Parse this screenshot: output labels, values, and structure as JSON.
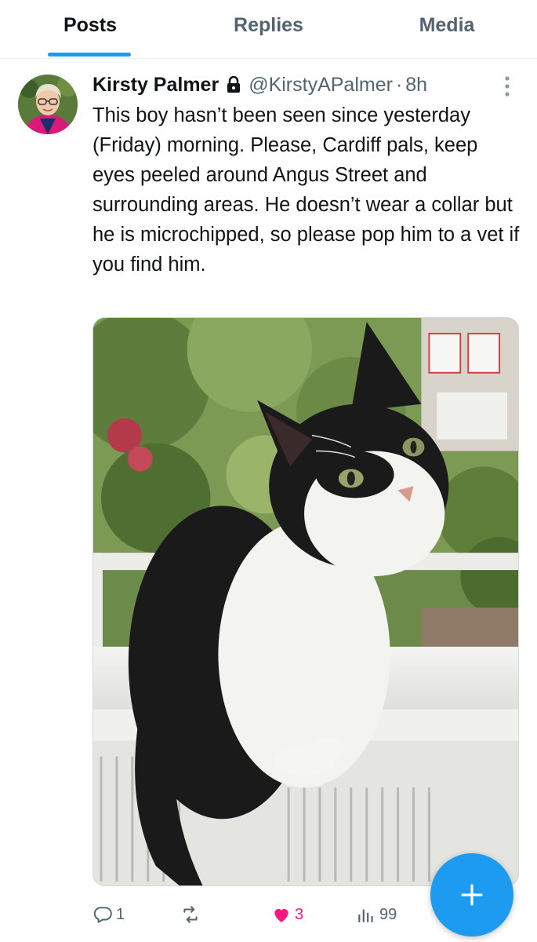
{
  "tabs": [
    {
      "label": "Posts",
      "active": true
    },
    {
      "label": "Replies",
      "active": false
    },
    {
      "label": "Media",
      "active": false
    }
  ],
  "post": {
    "author_name": "Kirsty Palmer",
    "protected": true,
    "handle": "@KirstyAPalmer",
    "separator": "·",
    "time": "8h",
    "text": "This boy hasn’t been seen since yesterday (Friday) morning. Please, Cardiff pals, keep eyes peeled around Angus Street and surrounding areas. He doesn’t wear a collar but he is microchipped, so please pop him to a vet if you find him.",
    "media": {
      "type": "photo",
      "subject": "black-and-white cat sitting on a windowsill"
    }
  },
  "actions": {
    "replies": "1",
    "reposts": "",
    "likes": "3",
    "views": "99",
    "liked": true
  },
  "icons": {
    "more": "more-vertical-icon",
    "lock": "lock-icon",
    "reply": "reply-bubble-icon",
    "repost": "repost-icon",
    "like": "heart-filled-icon",
    "views": "views-bars-icon",
    "compose": "plus-icon"
  },
  "colors": {
    "accent": "#1d9bf0",
    "like": "#f91880",
    "secondary_text": "#536471",
    "primary_text": "#0f1419"
  }
}
